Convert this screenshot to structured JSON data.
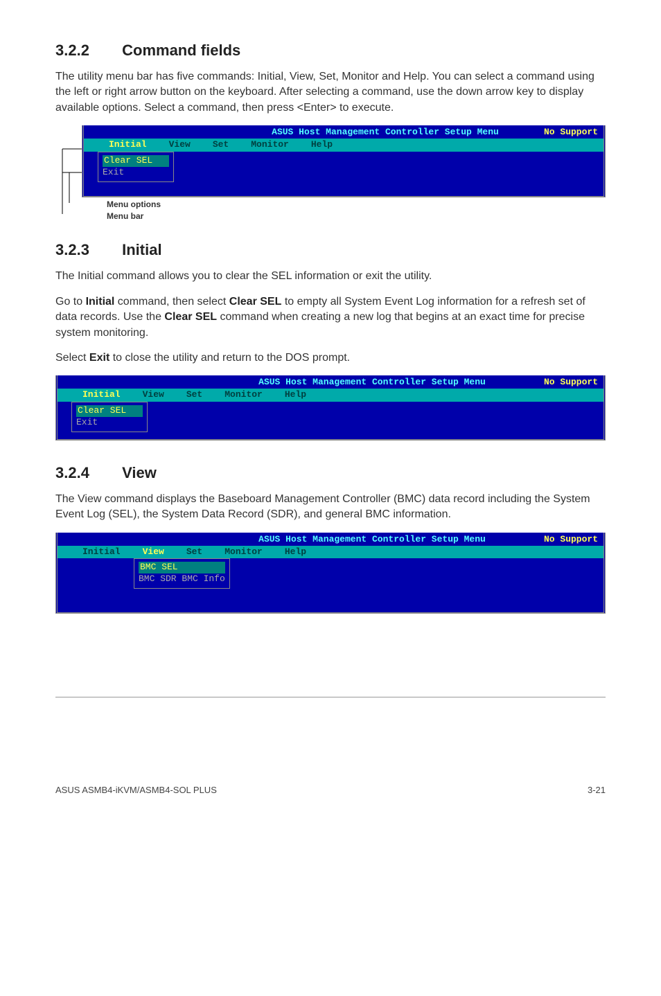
{
  "s322": {
    "heading_num": "3.2.2",
    "heading_title": "Command fields",
    "para1": "The utility menu bar has five commands: Initial, View, Set, Monitor and Help. You can select a command using the left or right arrow button on the keyboard. After selecting a command, use the down arrow key to display available options. Select a command, then press <Enter> to execute."
  },
  "terminal_common": {
    "title": "ASUS Host Management Controller Setup Menu",
    "support": "No Support",
    "menu": {
      "initial": "Initial",
      "view": "View",
      "set": "Set",
      "monitor": "Monitor",
      "help": "Help"
    }
  },
  "term1": {
    "items": [
      "Clear SEL",
      "Exit"
    ],
    "highlight_index": 0
  },
  "callouts": {
    "menu_options": "Menu options",
    "menu_bar": "Menu bar"
  },
  "s323": {
    "heading_num": "3.2.3",
    "heading_title": "Initial",
    "para1": "The Initial command allows you to clear the SEL information or exit the utility.",
    "para2_pre": "Go to ",
    "para2_b1": "Initial",
    "para2_mid1": " command, then select ",
    "para2_b2": "Clear SEL",
    "para2_mid2": " to empty all System Event Log information for a refresh set of data records. Use the ",
    "para2_b3": "Clear SEL",
    "para2_end": " command when creating a new log that begins at an exact time for precise system monitoring.",
    "para3_pre": "Select ",
    "para3_b1": "Exit",
    "para3_end": " to close the utility and return to the DOS prompt."
  },
  "term2": {
    "items": [
      "Clear SEL",
      "Exit"
    ],
    "highlight_index": 0
  },
  "s324": {
    "heading_num": "3.2.4",
    "heading_title": "View",
    "para1": "The View command displays the Baseboard Management Controller (BMC) data record including the System Event Log (SEL), the System Data Record (SDR), and general BMC information."
  },
  "term3": {
    "items": [
      "BMC SEL",
      "BMC SDR",
      "BMC Info"
    ],
    "highlight_index": 0
  },
  "footer": {
    "left": "ASUS ASMB4-iKVM/ASMB4-SOL PLUS",
    "right": "3-21"
  }
}
